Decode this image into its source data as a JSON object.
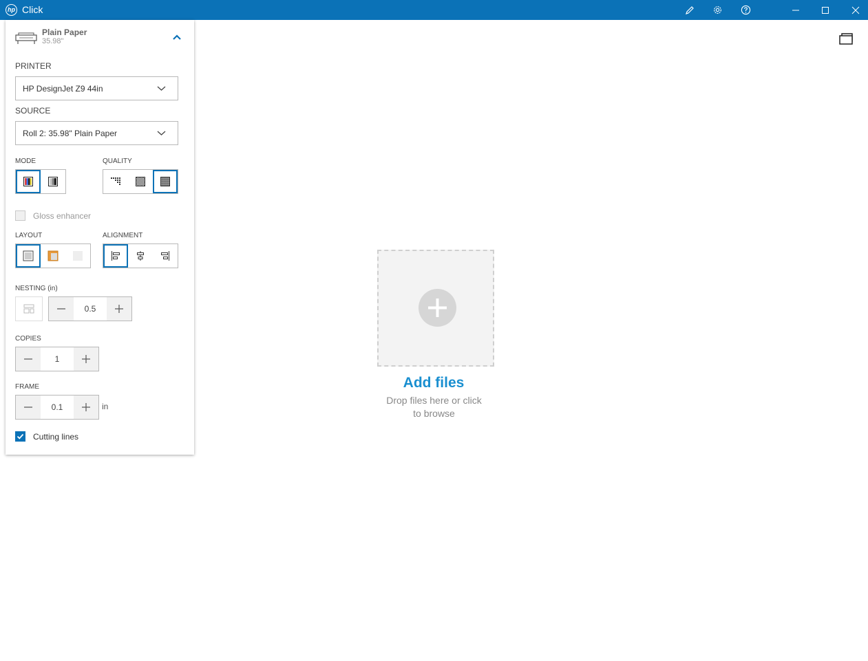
{
  "window": {
    "app_title": "Click",
    "logo_text": "hp"
  },
  "media": {
    "name": "Plain Paper",
    "size": "35.98\""
  },
  "printer": {
    "label": "PRINTER",
    "value": "HP DesignJet Z9 44in"
  },
  "source": {
    "label": "SOURCE",
    "value": "Roll 2: 35.98\" Plain Paper"
  },
  "mode": {
    "label": "MODE",
    "options": [
      "color",
      "grayscale"
    ],
    "selected": "color"
  },
  "quality": {
    "label": "QUALITY",
    "options": [
      "fast",
      "normal",
      "best"
    ],
    "selected": "best"
  },
  "gloss": {
    "label": "Gloss enhancer",
    "checked": false,
    "enabled": false
  },
  "layout": {
    "label": "LAYOUT",
    "options": [
      "fit",
      "custom",
      "none"
    ],
    "selected": "fit"
  },
  "alignment": {
    "label": "ALIGNMENT",
    "options": [
      "left",
      "center",
      "right"
    ],
    "selected": "left"
  },
  "nesting": {
    "label": "NESTING (in)",
    "value": "0.5"
  },
  "copies": {
    "label": "COPIES",
    "value": "1"
  },
  "frame": {
    "label": "FRAME",
    "value": "0.1",
    "unit": "in"
  },
  "cutting_lines": {
    "label": "Cutting lines",
    "checked": true
  },
  "dropzone": {
    "title": "Add files",
    "subtitle_line1": "Drop files here or click",
    "subtitle_line2": "to browse"
  },
  "colors": {
    "accent": "#0b72b7",
    "link": "#1a8fd0",
    "titlebar": "#0b72b7"
  }
}
